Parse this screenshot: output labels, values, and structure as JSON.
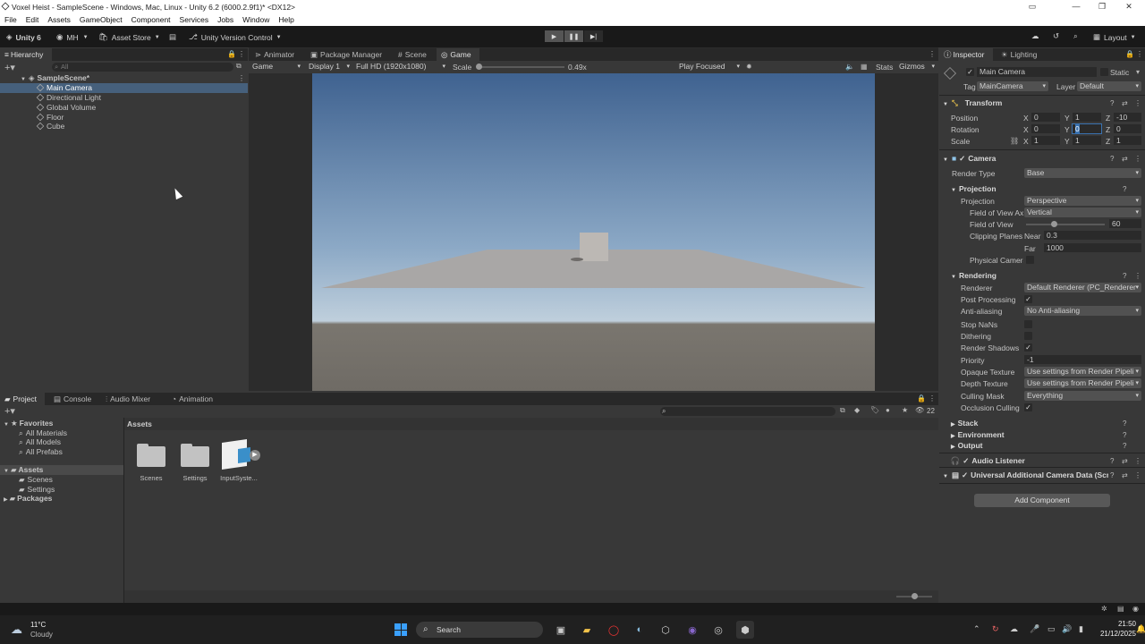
{
  "window": {
    "title": "Voxel Heist - SampleScene - Windows, Mac, Linux - Unity 6.2 (6000.2.9f1)* <DX12>"
  },
  "menu": [
    "File",
    "Edit",
    "Assets",
    "GameObject",
    "Component",
    "Services",
    "Jobs",
    "Window",
    "Help"
  ],
  "toolbar": {
    "unity": "Unity 6",
    "account": "MH",
    "asset_store": "Asset Store",
    "version_control": "Unity Version Control",
    "layout": "Layout"
  },
  "hierarchy": {
    "tab": "Hierarchy",
    "search_placeholder": "All",
    "scene": "SampleScene*",
    "items": [
      "Main Camera",
      "Directional Light",
      "Global Volume",
      "Floor",
      "Cube"
    ]
  },
  "center_tabs": [
    "Animator",
    "Package Manager",
    "Scene",
    "Game"
  ],
  "game_bar": {
    "mode": "Game",
    "display": "Display 1",
    "resolution": "Full HD (1920x1080)",
    "scale_label": "Scale",
    "scale_value": "0.49x",
    "play_mode": "Play Focused",
    "stats": "Stats",
    "gizmos": "Gizmos"
  },
  "scale_slider_fraction": 0.0,
  "bottom_tabs": [
    "Project",
    "Console",
    "Audio Mixer",
    "Animation"
  ],
  "project": {
    "favorites_label": "Favorites",
    "favorites": [
      "All Materials",
      "All Models",
      "All Prefabs"
    ],
    "assets_label": "Assets",
    "asset_folders": [
      "Scenes",
      "Settings"
    ],
    "packages_label": "Packages",
    "breadcrumb": "Assets",
    "items": [
      "Scenes",
      "Settings",
      "InputSyste..."
    ],
    "count": "22"
  },
  "inspector": {
    "tabs": [
      "Inspector",
      "Lighting"
    ],
    "object_name": "Main Camera",
    "static_label": "Static",
    "tag_label": "Tag",
    "tag_value": "MainCamera",
    "layer_label": "Layer",
    "layer_value": "Default",
    "transform": {
      "title": "Transform",
      "position": {
        "label": "Position",
        "x": "0",
        "y": "1",
        "z": "-10"
      },
      "rotation": {
        "label": "Rotation",
        "x": "0",
        "y": "0",
        "z": "0"
      },
      "scale": {
        "label": "Scale",
        "x": "1",
        "y": "1",
        "z": "1"
      }
    },
    "camera": {
      "title": "Camera",
      "render_type": {
        "label": "Render Type",
        "value": "Base"
      },
      "projection_header": "Projection",
      "projection": {
        "label": "Projection",
        "value": "Perspective"
      },
      "fov_axis": {
        "label": "Field of View Ax",
        "value": "Vertical"
      },
      "fov": {
        "label": "Field of View",
        "value": "60"
      },
      "clipping_label": "Clipping Planes",
      "near": {
        "label": "Near",
        "value": "0.3"
      },
      "far": {
        "label": "Far",
        "value": "1000"
      },
      "physical": {
        "label": "Physical Camera"
      },
      "rendering_header": "Rendering",
      "renderer": {
        "label": "Renderer",
        "value": "Default Renderer (PC_Renderer"
      },
      "post_processing": {
        "label": "Post Processing",
        "checked": true
      },
      "anti_aliasing": {
        "label": "Anti-aliasing",
        "value": "No Anti-aliasing"
      },
      "stop_nans": {
        "label": "Stop NaNs",
        "checked": false
      },
      "dithering": {
        "label": "Dithering",
        "checked": false
      },
      "render_shadows": {
        "label": "Render Shadows",
        "checked": true
      },
      "priority": {
        "label": "Priority",
        "value": "-1"
      },
      "opaque_texture": {
        "label": "Opaque Texture",
        "value": "Use settings from Render Pipeli"
      },
      "depth_texture": {
        "label": "Depth Texture",
        "value": "Use settings from Render Pipeli"
      },
      "culling_mask": {
        "label": "Culling Mask",
        "value": "Everything"
      },
      "occlusion": {
        "label": "Occlusion Culling",
        "checked": true
      },
      "stack": "Stack",
      "environment": "Environment",
      "output": "Output"
    },
    "audio_listener": "Audio Listener",
    "urp_data": "Universal Additional Camera Data (Scr",
    "add_component": "Add Component"
  },
  "taskbar": {
    "weather_temp": "11°C",
    "weather_desc": "Cloudy",
    "search": "Search",
    "time": "21:50",
    "date": "21/12/2025"
  },
  "colors": {
    "accent": "#3a72b0",
    "panel": "#383838",
    "dark": "#191919"
  }
}
